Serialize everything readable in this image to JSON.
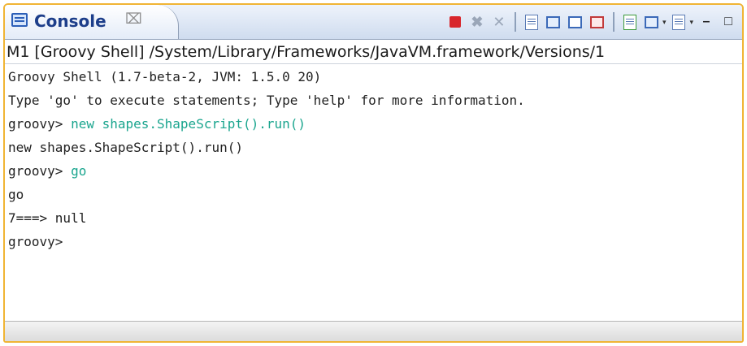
{
  "view": {
    "tab_label": "Console",
    "tab_close_glyph": "⌧",
    "process_line": "M1 [Groovy Shell] /System/Library/Frameworks/JavaVM.framework/Versions/1"
  },
  "toolbar": {
    "icons": [
      "terminate-icon",
      "remove-launch-icon",
      "remove-all-terminated-icon",
      "clear-console-icon",
      "scroll-lock-icon",
      "show-on-stdout-icon",
      "show-on-stderr-icon",
      "pin-console-icon",
      "display-console-icon",
      "open-console-icon",
      "minimize-icon",
      "maximize-icon"
    ]
  },
  "console": {
    "lines": [
      {
        "prompt": "",
        "text": "Groovy Shell (1.7-beta-2, JVM: 1.5.0 20)",
        "kind": "output"
      },
      {
        "prompt": "",
        "text": "Type 'go' to execute statements; Type 'help' for more information.",
        "kind": "output"
      },
      {
        "prompt": "groovy> ",
        "text": "new shapes.ShapeScript().run()",
        "kind": "input"
      },
      {
        "prompt": "",
        "text": "new shapes.ShapeScript().run()",
        "kind": "output"
      },
      {
        "prompt": "groovy> ",
        "text": "go",
        "kind": "input"
      },
      {
        "prompt": "",
        "text": "go",
        "kind": "output"
      },
      {
        "prompt": "",
        "text": "7===> null",
        "kind": "output"
      },
      {
        "prompt": "groovy> ",
        "text": "",
        "kind": "input"
      }
    ]
  },
  "colors": {
    "input": "#1aa58e",
    "output": "#222222",
    "focus_border": "#f0b434"
  }
}
